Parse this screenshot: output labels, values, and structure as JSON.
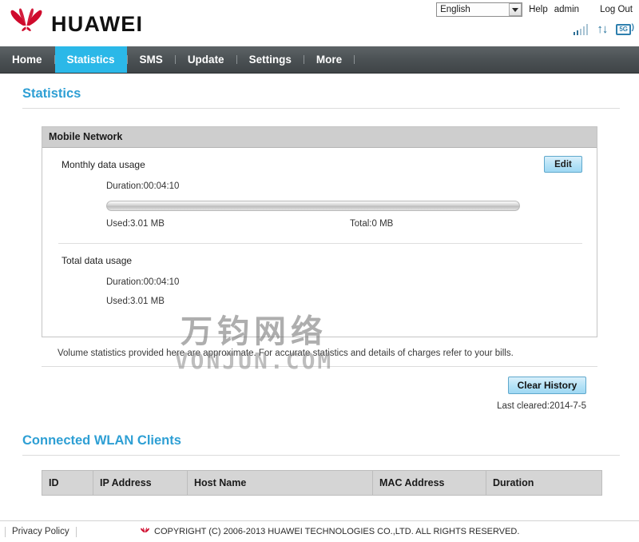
{
  "header": {
    "brand": "HUAWEI",
    "language": {
      "selected": "English",
      "icon": "chevron-down-icon"
    },
    "links": [
      {
        "label": "Help",
        "name": "help-link"
      },
      {
        "label": "admin",
        "name": "admin-link"
      },
      {
        "label": "Log Out",
        "name": "logout-link"
      }
    ],
    "status": {
      "signal_icon": "signal-bars-icon",
      "signal_bars_total": 5,
      "signal_bars_active": 2,
      "transfer_icon": "up-down-arrows-icon",
      "transfer_glyph": "↑↓",
      "network_badge": "5G",
      "network_icon": "network-5g-icon"
    }
  },
  "nav": {
    "items": [
      {
        "label": "Home",
        "active": false
      },
      {
        "label": "Statistics",
        "active": true
      },
      {
        "label": "SMS",
        "active": false
      },
      {
        "label": "Update",
        "active": false
      },
      {
        "label": "Settings",
        "active": false
      },
      {
        "label": "More",
        "active": false
      }
    ],
    "active_color": "#2bb8e8"
  },
  "page": {
    "title": "Statistics",
    "title_color": "#2e9fd4"
  },
  "mobile_network": {
    "panel_title": "Mobile Network",
    "monthly": {
      "title": "Monthly data usage",
      "edit_label": "Edit",
      "duration": "Duration:00:04:10",
      "used": "Used:3.01 MB",
      "total": "Total:0 MB",
      "progress_percent": 0
    },
    "total": {
      "title": "Total data usage",
      "duration": "Duration:00:04:10",
      "used": "Used:3.01 MB"
    }
  },
  "note": "Volume statistics provided here are approximate. For accurate statistics and details of charges refer to your bills.",
  "actions": {
    "clear_history_label": "Clear History",
    "last_cleared": "Last cleared:2014-7-5"
  },
  "clients": {
    "title": "Connected WLAN Clients",
    "columns": [
      "ID",
      "IP Address",
      "Host Name",
      "MAC Address",
      "Duration"
    ],
    "rows": []
  },
  "watermark": {
    "line1": "万钧网络",
    "line2": "VONJUN.COM"
  },
  "footer": {
    "privacy": "Privacy Policy",
    "copyright": "COPYRIGHT (C) 2006-2013 HUAWEI TECHNOLOGIES CO.,LTD. ALL RIGHTS RESERVED.",
    "logo_icon": "huawei-logo-icon"
  }
}
